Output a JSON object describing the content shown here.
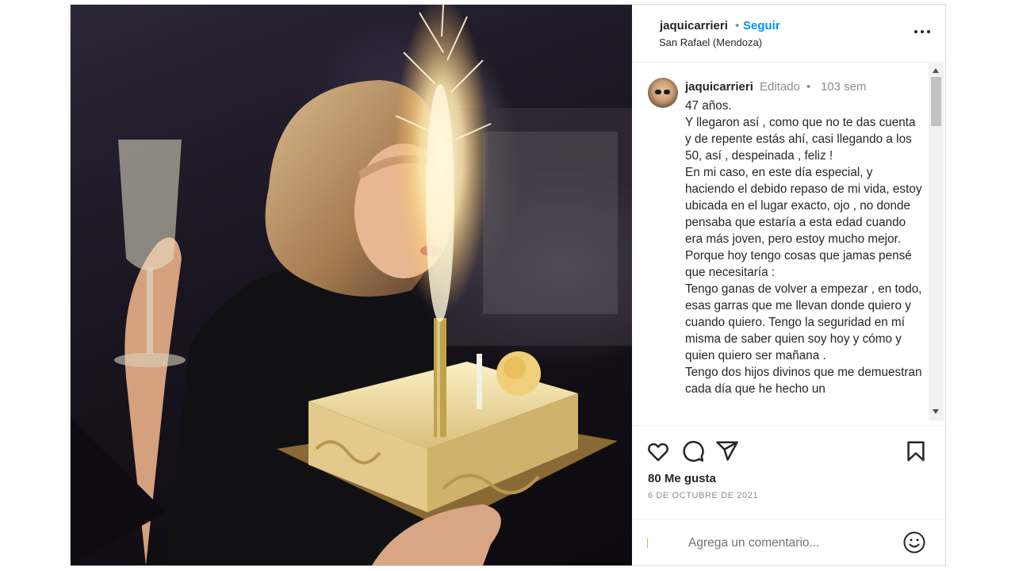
{
  "post": {
    "photo_alt": "",
    "header": {
      "username": "jaquicarrieri",
      "separator": "•",
      "follow_label": "Seguir",
      "location": "San Rafael (Mendoza)",
      "more_icon": "more-horizontal-icon"
    },
    "caption": {
      "username": "jaquicarrieri",
      "edited_label": "Editado",
      "separator": "•",
      "time_ago": "103 sem",
      "text": "47 años.\nY llegaron así , como que no te das cuenta y de repente estás ahí, casi llegando a los 50, así , despeinada , feliz !\nEn mi caso, en este día especial, y haciendo el debido repaso de mi vida, estoy ubicada en el lugar exacto, ojo , no donde pensaba que estaría a esta edad cuando era más joven, pero estoy mucho mejor. Porque hoy tengo cosas que jamas pensé que necesitaría :\nTengo ganas de volver a empezar , en todo, esas garras que me llevan donde quiero y cuando quiero. Tengo la seguridad en mí misma de saber quien soy hoy y cómo y quien quiero ser mañana .\nTengo dos hijos divinos que me demuestran cada día que he hecho un"
    },
    "actions": {
      "like_icon": "heart-icon",
      "comment_icon": "comment-bubble-icon",
      "share_icon": "paper-plane-icon",
      "save_icon": "bookmark-icon",
      "likes_text": "80 Me gusta",
      "date_text": "6 DE OCTUBRE DE 2021"
    },
    "comment": {
      "placeholder": "Agrega un comentario...",
      "emoji_icon": "smiley-face-icon"
    }
  },
  "colors": {
    "link_blue": "#0095f6",
    "text": "#262626",
    "muted": "#8e8e8e",
    "border": "#dbdbdb"
  }
}
